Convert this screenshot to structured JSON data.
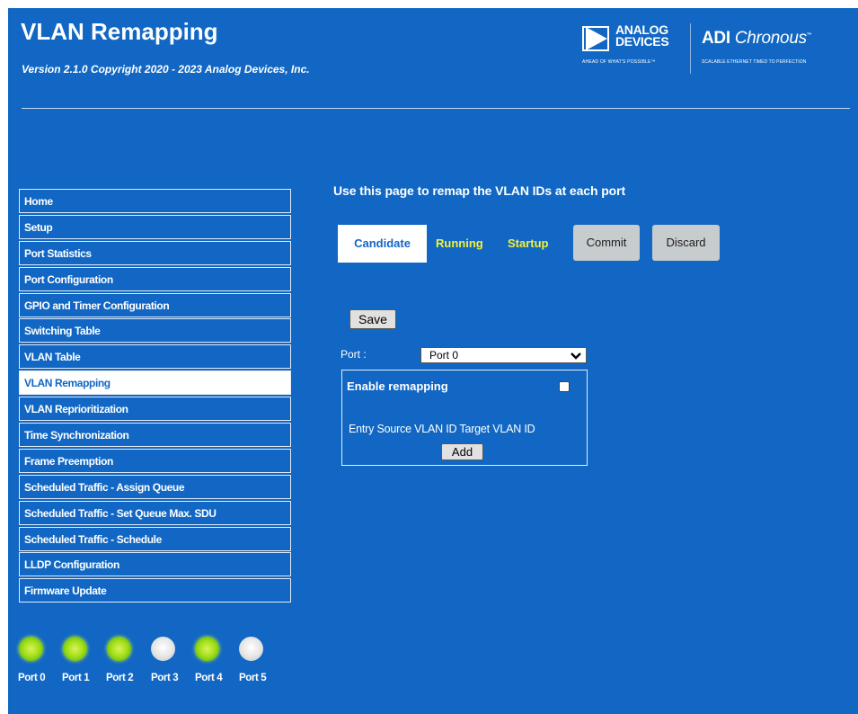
{
  "header": {
    "title": "VLAN Remapping",
    "version": "Version 2.1.0 Copyright 2020 - 2023 Analog Devices, Inc."
  },
  "logo": {
    "analog": "ANALOG",
    "devices": "DEVICES",
    "analog_tagline": "AHEAD OF WHAT'S POSSIBLE™",
    "adi": "ADI",
    "chronous": "Chronous",
    "chronous_tagline": "SCALABLE ETHERNET TIMED TO PERFECTION"
  },
  "nav": {
    "items": [
      {
        "label": "Home"
      },
      {
        "label": "Setup"
      },
      {
        "label": "Port Statistics"
      },
      {
        "label": "Port Configuration"
      },
      {
        "label": "GPIO and Timer Configuration"
      },
      {
        "label": "Switching Table"
      },
      {
        "label": "VLAN Table"
      },
      {
        "label": "VLAN Remapping"
      },
      {
        "label": "VLAN Reprioritization"
      },
      {
        "label": "Time Synchronization"
      },
      {
        "label": "Frame Preemption"
      },
      {
        "label": "Scheduled Traffic - Assign Queue"
      },
      {
        "label": "Scheduled Traffic - Set Queue Max. SDU"
      },
      {
        "label": "Scheduled Traffic - Schedule"
      },
      {
        "label": "LLDP Configuration"
      },
      {
        "label": "Firmware Update"
      }
    ],
    "active_index": 7
  },
  "ports": [
    {
      "label": "Port 0",
      "status": "on"
    },
    {
      "label": "Port 1",
      "status": "on"
    },
    {
      "label": "Port 2",
      "status": "on"
    },
    {
      "label": "Port 3",
      "status": "off"
    },
    {
      "label": "Port 4",
      "status": "on"
    },
    {
      "label": "Port 5",
      "status": "off"
    }
  ],
  "main": {
    "heading": "Use this page to remap the VLAN IDs at each port",
    "tabs": {
      "candidate": "Candidate",
      "running": "Running",
      "startup": "Startup"
    },
    "commit_label": "Commit",
    "discard_label": "Discard",
    "save_label": "Save",
    "port_label": "Port :",
    "port_selected": "Port 0",
    "enable_label": "Enable remapping",
    "enable_checked": false,
    "table_header": "Entry Source VLAN ID Target VLAN ID",
    "add_label": "Add"
  },
  "colors": {
    "background": "#1167c3",
    "tab_inactive_text": "#f3f13d",
    "led_on": "#a5e01a",
    "led_off": "#e4e4e4"
  }
}
